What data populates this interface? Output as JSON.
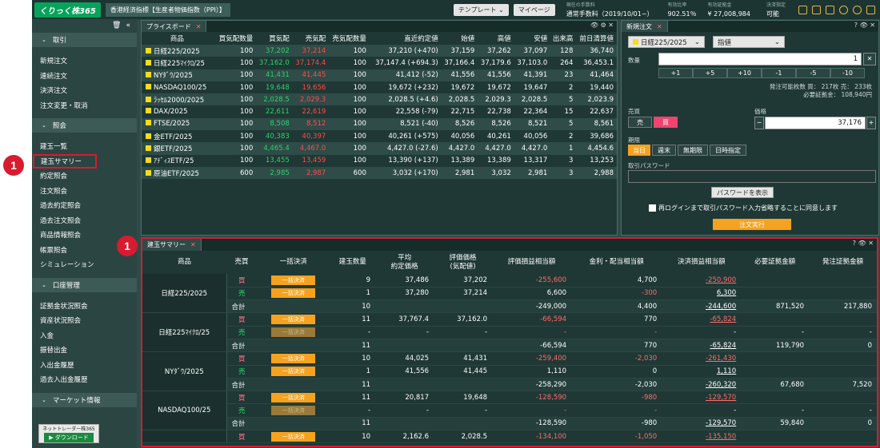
{
  "header": {
    "logo": "くりっく株365",
    "ticker": "香港経済指標【生産者物価指数（PPI）】",
    "template_btn": "テンプレート ⌄",
    "mypage_btn": "マイページ",
    "fee_label": "現在の手数料",
    "fee_value": "通常手数料（2019/10/01~）",
    "ratio_label": "有効比率",
    "ratio_value": "902.51％",
    "margin_label": "有効証拠金",
    "margin_value": "¥ 27,008,984",
    "settle_label": "決済指定",
    "settle_value": "可能"
  },
  "sidebar": {
    "sections": [
      {
        "title": "取引",
        "items": [
          "新規注文",
          "連続注文",
          "決済注文",
          "注文変更・取消"
        ]
      },
      {
        "title": "照会",
        "items": [
          "建玉一覧",
          "建玉サマリー",
          "約定照会",
          "注文照会",
          "過去約定照会",
          "過去注文照会",
          "商品情報照会",
          "帳票照会",
          "シミュレーション"
        ]
      },
      {
        "title": "口座管理",
        "items": [
          "証拠金状況照会",
          "資産状況照会",
          "入金",
          "振替出金",
          "入出金履歴",
          "過去入出金履歴"
        ]
      },
      {
        "title": "マーケット情報",
        "items": []
      }
    ],
    "download_title": "ネットトレーダー株365",
    "download_btn": "▶ ダウンロード"
  },
  "price_board": {
    "tab": "プライスボード",
    "columns": [
      "商品",
      "買気配数量",
      "買気配",
      "売気配",
      "売気配数量",
      "直近約定値",
      "始値",
      "高値",
      "安値",
      "出来高",
      "前日清算値"
    ],
    "rows": [
      [
        "日経225/2025",
        "100",
        "37,202",
        "37,214",
        "100",
        "37,210 (+470)",
        "37,159",
        "37,262",
        "37,097",
        "128",
        "36,740"
      ],
      [
        "日経225ﾏｲｸﾛ/25",
        "100",
        "37,162.0",
        "37,174.4",
        "100",
        "37,147.4 (+694.3)",
        "37,166.4",
        "37,179.6",
        "37,103.0",
        "264",
        "36,453.1"
      ],
      [
        "NYﾀﾞｳ/2025",
        "100",
        "41,431",
        "41,445",
        "100",
        "41,412 (-52)",
        "41,556",
        "41,556",
        "41,391",
        "23",
        "41,464"
      ],
      [
        "NASDAQ100/25",
        "100",
        "19,648",
        "19,656",
        "100",
        "19,672 (+232)",
        "19,672",
        "19,672",
        "19,647",
        "2",
        "19,440"
      ],
      [
        "ﾗｯｾﾙ2000/2025",
        "100",
        "2,028.5",
        "2,029.3",
        "100",
        "2,028.5 (+4.6)",
        "2,028.5",
        "2,029.3",
        "2,028.5",
        "5",
        "2,023.9"
      ],
      [
        "DAX/2025",
        "100",
        "22,611",
        "22,619",
        "100",
        "22,558 (-79)",
        "22,715",
        "22,738",
        "22,364",
        "15",
        "22,637"
      ],
      [
        "FTSE/2025",
        "100",
        "8,508",
        "8,512",
        "100",
        "8,521 (-40)",
        "8,526",
        "8,526",
        "8,521",
        "5",
        "8,561"
      ],
      [
        "金ETF/2025",
        "100",
        "40,383",
        "40,397",
        "100",
        "40,261 (+575)",
        "40,056",
        "40,261",
        "40,056",
        "2",
        "39,686"
      ],
      [
        "銀ETF/2025",
        "100",
        "4,465.4",
        "4,467.0",
        "100",
        "4,427.0 (-27.6)",
        "4,427.0",
        "4,427.0",
        "4,427.0",
        "1",
        "4,454.6"
      ],
      [
        "ｱﾃﾞｨｽETF/25",
        "100",
        "13,455",
        "13,459",
        "100",
        "13,390 (+137)",
        "13,389",
        "13,389",
        "13,317",
        "3",
        "13,253"
      ],
      [
        "原油ETF/2025",
        "600",
        "2,985",
        "2,987",
        "600",
        "3,032 (+170)",
        "2,981",
        "3,032",
        "2,981",
        "3",
        "2,988"
      ]
    ]
  },
  "order": {
    "tab": "新規注文",
    "product": "日経225/2025",
    "type": "指値",
    "qty_label": "数量",
    "qty": "1",
    "steps": [
      "+1",
      "+5",
      "+10",
      "-1",
      "-5",
      "-10"
    ],
    "avail": "発注可能枚数  買：  217枚  売：  233枚",
    "req_margin": "必要証拠金：  108,940円",
    "side_label": "売買",
    "sell": "売",
    "buy": "買",
    "price_label": "価格",
    "price": "37,176",
    "period_label": "期限",
    "periods": [
      "当日",
      "週末",
      "無期限",
      "日時指定"
    ],
    "pw_label": "取引パスワード",
    "pw_show": "パスワードを表示",
    "agree": "再ログインまで取引パスワード入力省略することに同意します",
    "submit": "注文実行"
  },
  "summary": {
    "tab": "建玉サマリー",
    "columns": [
      "商品",
      "売買",
      "一括決済",
      "建玉数量",
      "平均\n約定価格",
      "評価価格\n(気配値)",
      "評価損益相当額",
      "金利・配当相当額",
      "決済損益相当額",
      "必要証拠金額",
      "発注証拠金額"
    ],
    "groups": [
      {
        "name": "日経225/2025",
        "rows": [
          {
            "side": "買",
            "btn": "一括決済",
            "q": "9",
            "avg": "37,486",
            "val": "37,202",
            "pl": "-255,600",
            "int": "4,700",
            "set": "-250,900",
            "req": "",
            "ord": ""
          },
          {
            "side": "売",
            "btn": "一括決済",
            "q": "1",
            "avg": "37,280",
            "val": "37,214",
            "pl": "6,600",
            "int": "-300",
            "set": "6,300",
            "req": "",
            "ord": ""
          },
          {
            "side": "合計",
            "btn": "",
            "q": "10",
            "avg": "",
            "val": "",
            "pl": "-249,000",
            "int": "4,400",
            "set": "-244,600",
            "req": "871,520",
            "ord": "217,880"
          }
        ]
      },
      {
        "name": "日経225ﾏｲｸﾛ/25",
        "rows": [
          {
            "side": "買",
            "btn": "一括決済",
            "q": "11",
            "avg": "37,767.4",
            "val": "37,162.0",
            "pl": "-66,594",
            "int": "770",
            "set": "-65,824",
            "req": "",
            "ord": ""
          },
          {
            "side": "売",
            "btn": "一括決済",
            "q": "-",
            "avg": "-",
            "val": "-",
            "pl": "-",
            "int": "-",
            "set": "-",
            "req": "-",
            "ord": "-"
          },
          {
            "side": "合計",
            "btn": "",
            "q": "11",
            "avg": "",
            "val": "",
            "pl": "-66,594",
            "int": "770",
            "set": "-65,824",
            "req": "119,790",
            "ord": "0"
          }
        ]
      },
      {
        "name": "NYﾀﾞｳ/2025",
        "rows": [
          {
            "side": "買",
            "btn": "一括決済",
            "q": "10",
            "avg": "44,025",
            "val": "41,431",
            "pl": "-259,400",
            "int": "-2,030",
            "set": "-261,430",
            "req": "",
            "ord": ""
          },
          {
            "side": "売",
            "btn": "一括決済",
            "q": "1",
            "avg": "41,556",
            "val": "41,445",
            "pl": "1,110",
            "int": "0",
            "set": "1,110",
            "req": "",
            "ord": ""
          },
          {
            "side": "合計",
            "btn": "",
            "q": "11",
            "avg": "",
            "val": "",
            "pl": "-258,290",
            "int": "-2,030",
            "set": "-260,320",
            "req": "67,680",
            "ord": "7,520"
          }
        ]
      },
      {
        "name": "NASDAQ100/25",
        "rows": [
          {
            "side": "買",
            "btn": "一括決済",
            "q": "11",
            "avg": "20,817",
            "val": "19,648",
            "pl": "-128,590",
            "int": "-980",
            "set": "-129,570",
            "req": "",
            "ord": ""
          },
          {
            "side": "売",
            "btn": "一括決済",
            "q": "-",
            "avg": "-",
            "val": "-",
            "pl": "-",
            "int": "-",
            "set": "-",
            "req": "-",
            "ord": "-"
          },
          {
            "side": "合計",
            "btn": "",
            "q": "11",
            "avg": "",
            "val": "",
            "pl": "-128,590",
            "int": "-980",
            "set": "-129,570",
            "req": "59,840",
            "ord": "0"
          }
        ]
      },
      {
        "name": "",
        "rows": [
          {
            "side": "買",
            "btn": "一括決済",
            "q": "10",
            "avg": "2,162.6",
            "val": "2,028.5",
            "pl": "-134,100",
            "int": "-1,050",
            "set": "-135,150",
            "req": "",
            "ord": ""
          }
        ]
      }
    ]
  },
  "badges": [
    "1",
    "1"
  ]
}
